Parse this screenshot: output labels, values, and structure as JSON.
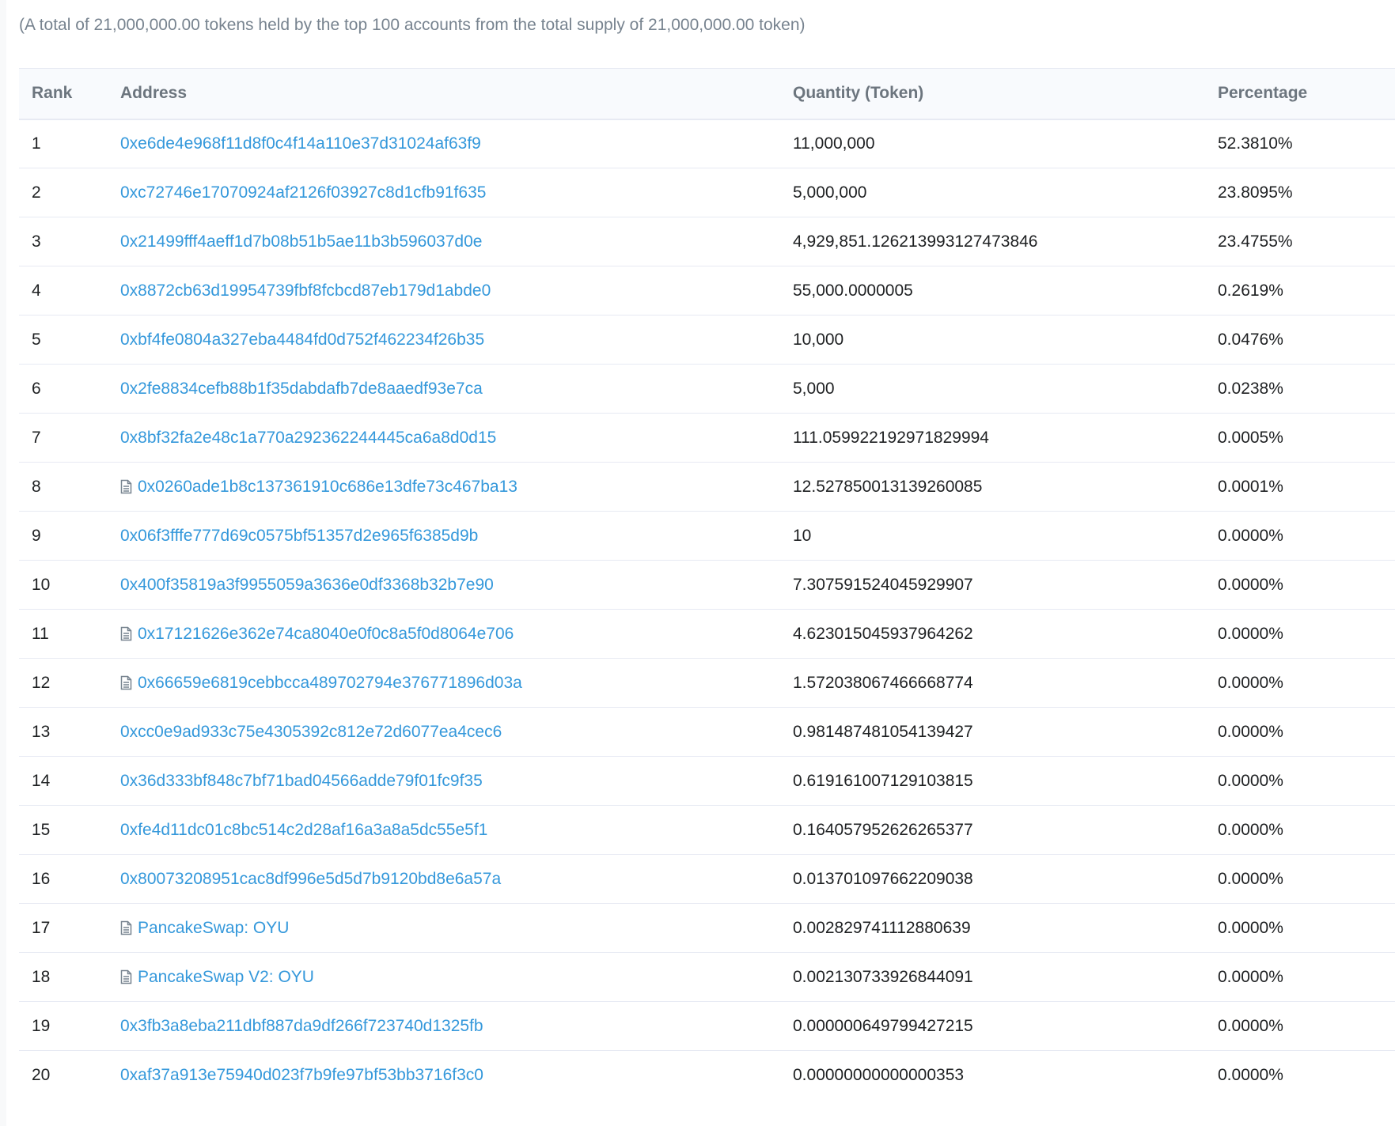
{
  "summary": "(A total of 21,000,000.00 tokens held by the top 100 accounts from the total supply of 21,000,000.00 token)",
  "colors": {
    "link": "#3498db",
    "text": "#1e2022",
    "muted": "#77838f",
    "border": "#e7eaf3",
    "header_bg": "#f8fafd"
  },
  "table": {
    "headers": {
      "rank": "Rank",
      "address": "Address",
      "quantity": "Quantity (Token)",
      "percentage": "Percentage"
    },
    "rows": [
      {
        "rank": "1",
        "address": "0xe6de4e968f11d8f0c4f14a110e37d31024af63f9",
        "contract": false,
        "quantity": "11,000,000",
        "percentage": "52.3810%"
      },
      {
        "rank": "2",
        "address": "0xc72746e17070924af2126f03927c8d1cfb91f635",
        "contract": false,
        "quantity": "5,000,000",
        "percentage": "23.8095%"
      },
      {
        "rank": "3",
        "address": "0x21499fff4aeff1d7b08b51b5ae11b3b596037d0e",
        "contract": false,
        "quantity": "4,929,851.126213993127473846",
        "percentage": "23.4755%"
      },
      {
        "rank": "4",
        "address": "0x8872cb63d19954739fbf8fcbcd87eb179d1abde0",
        "contract": false,
        "quantity": "55,000.0000005",
        "percentage": "0.2619%"
      },
      {
        "rank": "5",
        "address": "0xbf4fe0804a327eba4484fd0d752f462234f26b35",
        "contract": false,
        "quantity": "10,000",
        "percentage": "0.0476%"
      },
      {
        "rank": "6",
        "address": "0x2fe8834cefb88b1f35dabdafb7de8aaedf93e7ca",
        "contract": false,
        "quantity": "5,000",
        "percentage": "0.0238%"
      },
      {
        "rank": "7",
        "address": "0x8bf32fa2e48c1a770a292362244445ca6a8d0d15",
        "contract": false,
        "quantity": "111.059922192971829994",
        "percentage": "0.0005%"
      },
      {
        "rank": "8",
        "address": "0x0260ade1b8c137361910c686e13dfe73c467ba13",
        "contract": true,
        "quantity": "12.527850013139260085",
        "percentage": "0.0001%"
      },
      {
        "rank": "9",
        "address": "0x06f3fffe777d69c0575bf51357d2e965f6385d9b",
        "contract": false,
        "quantity": "10",
        "percentage": "0.0000%"
      },
      {
        "rank": "10",
        "address": "0x400f35819a3f9955059a3636e0df3368b32b7e90",
        "contract": false,
        "quantity": "7.307591524045929907",
        "percentage": "0.0000%"
      },
      {
        "rank": "11",
        "address": "0x17121626e362e74ca8040e0f0c8a5f0d8064e706",
        "contract": true,
        "quantity": "4.623015045937964262",
        "percentage": "0.0000%"
      },
      {
        "rank": "12",
        "address": "0x66659e6819cebbcca489702794e376771896d03a",
        "contract": true,
        "quantity": "1.572038067466668774",
        "percentage": "0.0000%"
      },
      {
        "rank": "13",
        "address": "0xcc0e9ad933c75e4305392c812e72d6077ea4cec6",
        "contract": false,
        "quantity": "0.981487481054139427",
        "percentage": "0.0000%"
      },
      {
        "rank": "14",
        "address": "0x36d333bf848c7bf71bad04566adde79f01fc9f35",
        "contract": false,
        "quantity": "0.619161007129103815",
        "percentage": "0.0000%"
      },
      {
        "rank": "15",
        "address": "0xfe4d11dc01c8bc514c2d28af16a3a8a5dc55e5f1",
        "contract": false,
        "quantity": "0.164057952626265377",
        "percentage": "0.0000%"
      },
      {
        "rank": "16",
        "address": "0x80073208951cac8df996e5d5d7b9120bd8e6a57a",
        "contract": false,
        "quantity": "0.013701097662209038",
        "percentage": "0.0000%"
      },
      {
        "rank": "17",
        "address": "PancakeSwap: OYU",
        "contract": true,
        "quantity": "0.002829741112880639",
        "percentage": "0.0000%"
      },
      {
        "rank": "18",
        "address": "PancakeSwap V2: OYU",
        "contract": true,
        "quantity": "0.002130733926844091",
        "percentage": "0.0000%"
      },
      {
        "rank": "19",
        "address": "0x3fb3a8eba211dbf887da9df266f723740d1325fb",
        "contract": false,
        "quantity": "0.000000649799427215",
        "percentage": "0.0000%"
      },
      {
        "rank": "20",
        "address": "0xaf37a913e75940d023f7b9fe97bf53bb3716f3c0",
        "contract": false,
        "quantity": "0.00000000000000353",
        "percentage": "0.0000%"
      }
    ]
  },
  "icons": {
    "contract": "contract-document-icon"
  }
}
